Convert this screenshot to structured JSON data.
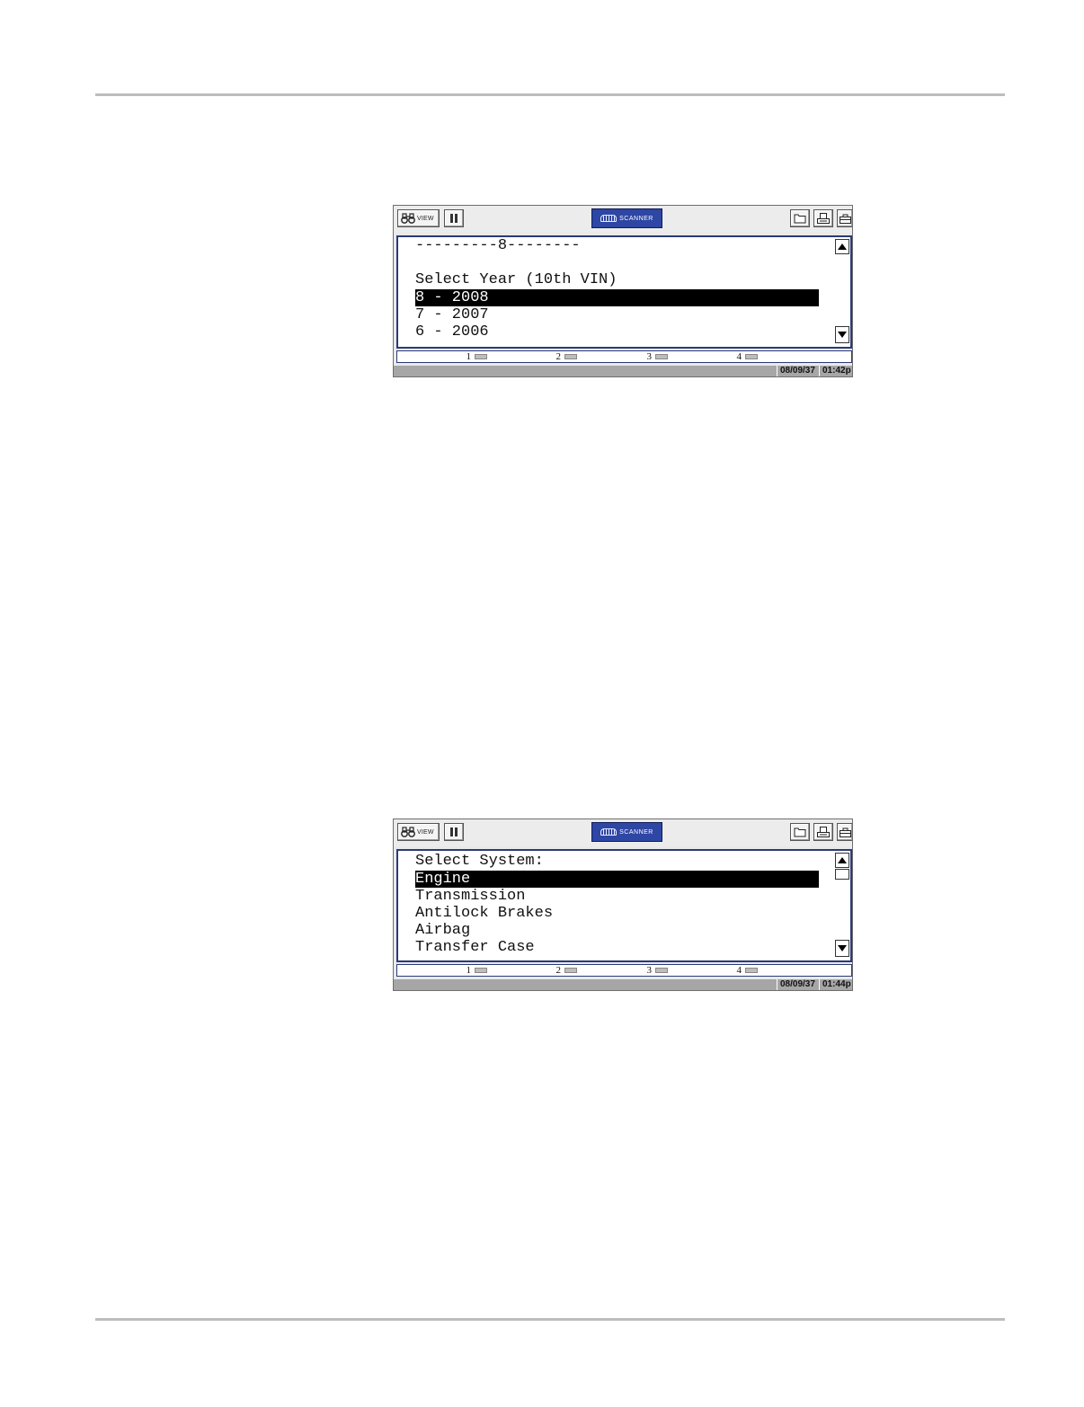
{
  "screens": [
    {
      "toolbar": {
        "view_label": "VIEW",
        "scanner_label": "SCANNER"
      },
      "lines": [
        {
          "text": "---------8--------",
          "selected": false
        },
        {
          "text": "",
          "selected": false
        },
        {
          "text": "Select Year (10th VIN)",
          "selected": false
        },
        {
          "text": "8 - 2008",
          "selected": true
        },
        {
          "text": "7 - 2007",
          "selected": false
        },
        {
          "text": "6 - 2006",
          "selected": false
        }
      ],
      "function_keys": [
        "1",
        "2",
        "3",
        "4"
      ],
      "status": {
        "date": "08/09/37",
        "time": "01:42p"
      }
    },
    {
      "toolbar": {
        "view_label": "VIEW",
        "scanner_label": "SCANNER"
      },
      "lines": [
        {
          "text": "Select System:",
          "selected": false
        },
        {
          "text": "Engine",
          "selected": true
        },
        {
          "text": "Transmission",
          "selected": false
        },
        {
          "text": "Antilock Brakes",
          "selected": false
        },
        {
          "text": "Airbag",
          "selected": false
        },
        {
          "text": "Transfer Case",
          "selected": false
        }
      ],
      "function_keys": [
        "1",
        "2",
        "3",
        "4"
      ],
      "status": {
        "date": "08/09/37",
        "time": "01:44p"
      }
    }
  ]
}
